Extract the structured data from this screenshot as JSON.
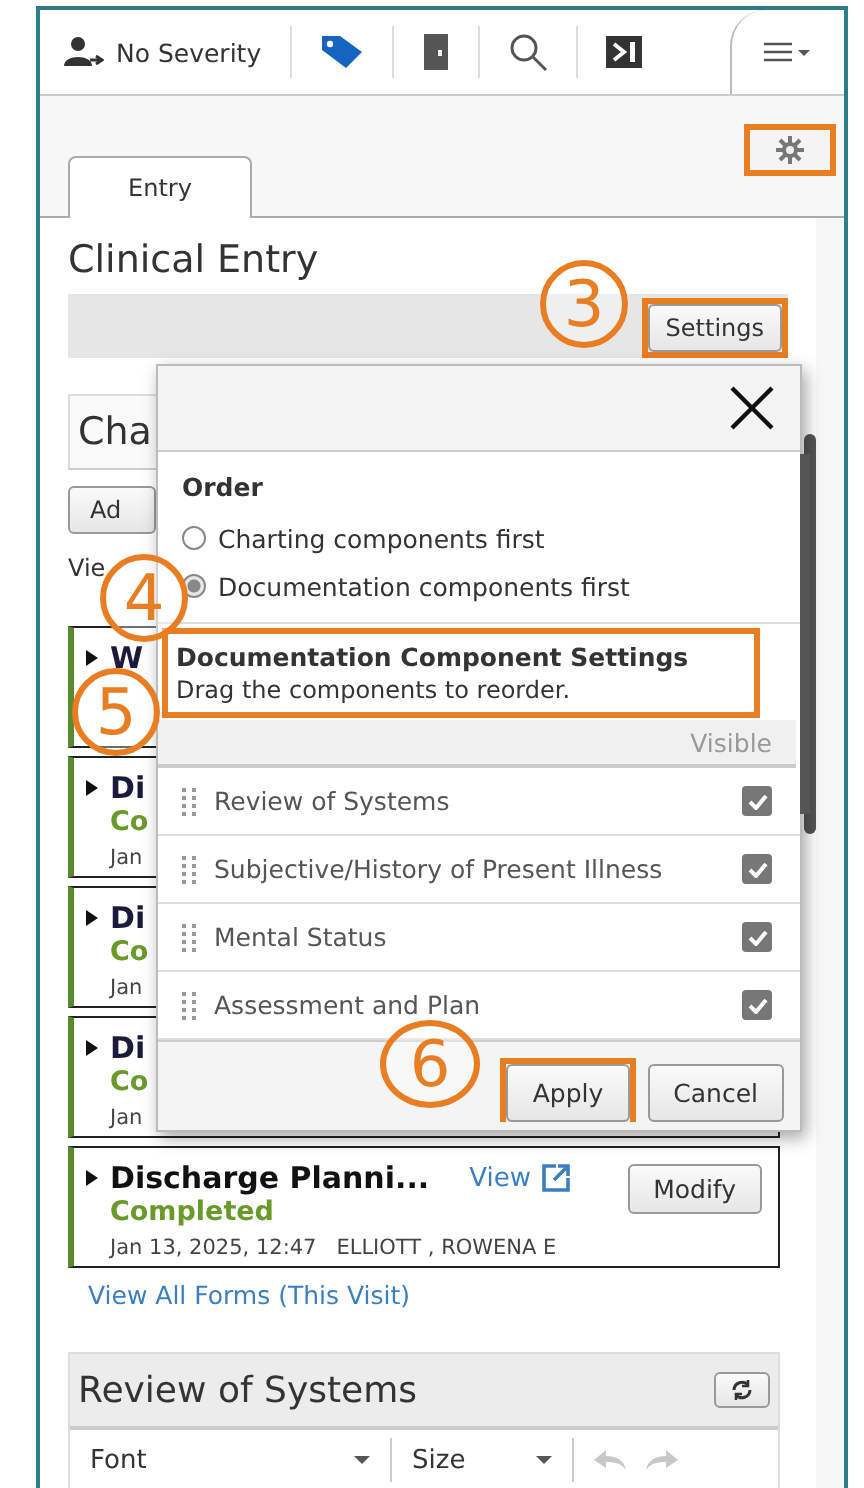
{
  "toolbar": {
    "severity": "No Severity"
  },
  "tabs": [
    {
      "label": "Entry",
      "selected": true
    }
  ],
  "title": "Clinical Entry",
  "settings_button": "Settings",
  "background_section": {
    "heading": "Cha",
    "add_button": "Ad",
    "view_label": "Vie"
  },
  "forms": [
    {
      "title": "W"
    },
    {
      "title": "Di",
      "status": "Co",
      "date": "Jan"
    },
    {
      "title": "Di",
      "status": "Co",
      "date": "Jan"
    },
    {
      "title": "Di",
      "status": "Co",
      "date": "Jan"
    },
    {
      "title": "Discharge Planni...",
      "status": "Completed",
      "date": "Jan 13, 2025, 12:47",
      "author": "ELLIOTT , ROWENA E",
      "view_link": "View",
      "modify_button": "Modify"
    }
  ],
  "view_all_link": "View All Forms (This Visit)",
  "ros_panel": {
    "title": "Review of Systems",
    "font_select": "Font",
    "size_select": "Size"
  },
  "dialog": {
    "order_heading": "Order",
    "order_options": [
      {
        "label": "Charting components first",
        "selected": false
      },
      {
        "label": "Documentation components first",
        "selected": true
      }
    ],
    "settings_heading": "Documentation Component Settings",
    "settings_hint": "Drag the components to reorder.",
    "visible_column": "Visible",
    "components": [
      {
        "label": "Review of Systems",
        "checked": true
      },
      {
        "label": "Subjective/History of Present Illness",
        "checked": true
      },
      {
        "label": "Mental Status",
        "checked": true
      },
      {
        "label": "Assessment and Plan",
        "checked": true
      }
    ],
    "apply_button": "Apply",
    "cancel_button": "Cancel"
  },
  "step_numbers": [
    "3",
    "4",
    "5",
    "6"
  ]
}
